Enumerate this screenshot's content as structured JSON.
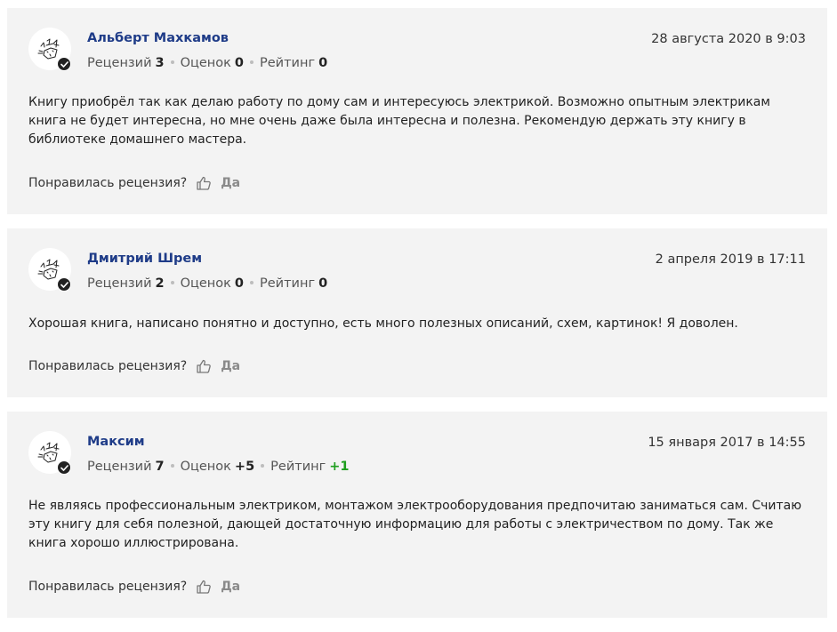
{
  "reviews": [
    {
      "author": "Альберт Махкамов",
      "date": "28 августа 2020 в 9:03",
      "stats": {
        "reviews_label": "Рецензий",
        "reviews_value": "3",
        "ratings_label": "Оценок",
        "ratings_value": "0",
        "rating_label": "Рейтинг",
        "rating_value": "0"
      },
      "text": "Книгу приобрёл так как делаю работу по дому сам и интересуюсь электрикой. Возможно опытным электрикам книга не будет интересна, но мне очень даже была интересна и полезна. Рекомендую держать эту книгу в библиотеке домашнего мастера.",
      "helpful_question": "Понравилась рецензия?",
      "helpful_yes": "Да"
    },
    {
      "author": "Дмитрий Шрем",
      "date": "2 апреля 2019 в 17:11",
      "stats": {
        "reviews_label": "Рецензий",
        "reviews_value": "2",
        "ratings_label": "Оценок",
        "ratings_value": "0",
        "rating_label": "Рейтинг",
        "rating_value": "0"
      },
      "text": "Хорошая книга, написано понятно и доступно, есть много полезных описаний, схем, картинок! Я доволен.",
      "helpful_question": "Понравилась рецензия?",
      "helpful_yes": "Да"
    },
    {
      "author": "Максим",
      "date": "15 января 2017 в 14:55",
      "stats": {
        "reviews_label": "Рецензий",
        "reviews_value": "7",
        "ratings_label": "Оценок",
        "ratings_value": "+5",
        "rating_label": "Рейтинг",
        "rating_value": "+1"
      },
      "text": "Не являясь профессиональным электриком, монтажом электрооборудования предпочитаю заниматься сам. Считаю эту книгу для себя полезной, дающей достаточную информацию для работы с электричеством по дому. Так же книга хорошо иллюстрирована.",
      "helpful_question": "Понравилась рецензия?",
      "helpful_yes": "Да"
    }
  ],
  "icons": {
    "avatar": "fox-avatar-icon",
    "verified": "checkmark-icon",
    "like": "thumbs-up-icon"
  },
  "colors": {
    "card_background": "#f3f3f3",
    "author_name": "#1f3c88",
    "positive_rating": "#1e9e1e",
    "muted_label": "#8a8a8a"
  }
}
